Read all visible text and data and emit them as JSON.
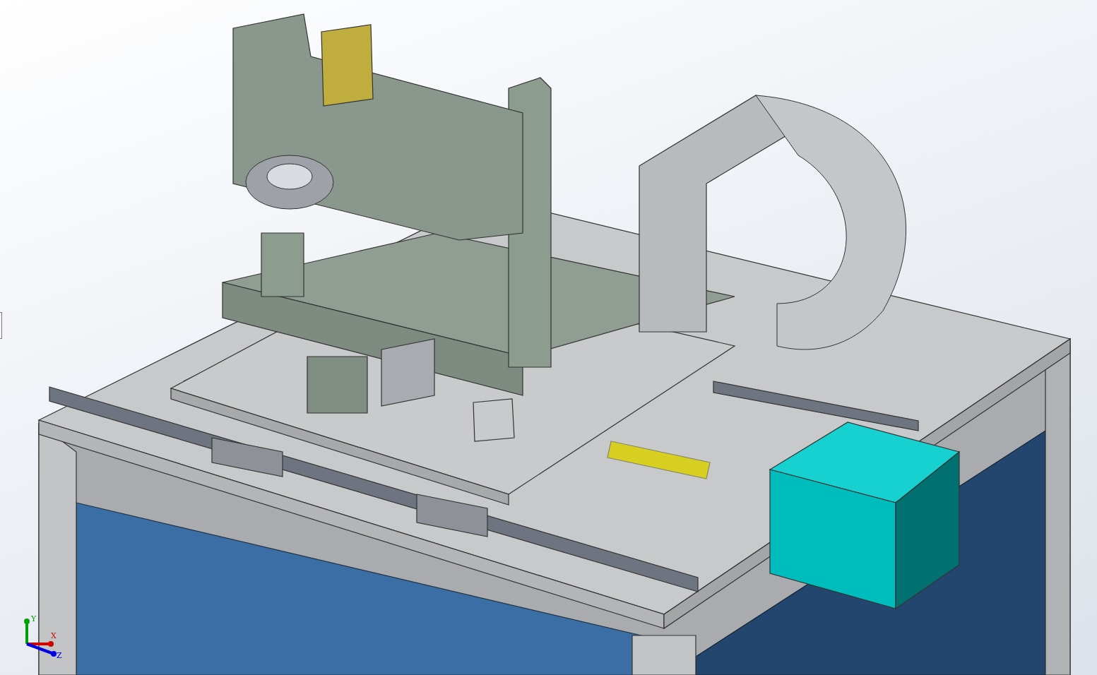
{
  "viewport": {
    "triad": {
      "axes": [
        {
          "label": "Y",
          "color": "#00a000"
        },
        {
          "label": "X",
          "color": "#d00000"
        },
        {
          "label": "Z",
          "color": "#0000e0"
        }
      ]
    }
  }
}
